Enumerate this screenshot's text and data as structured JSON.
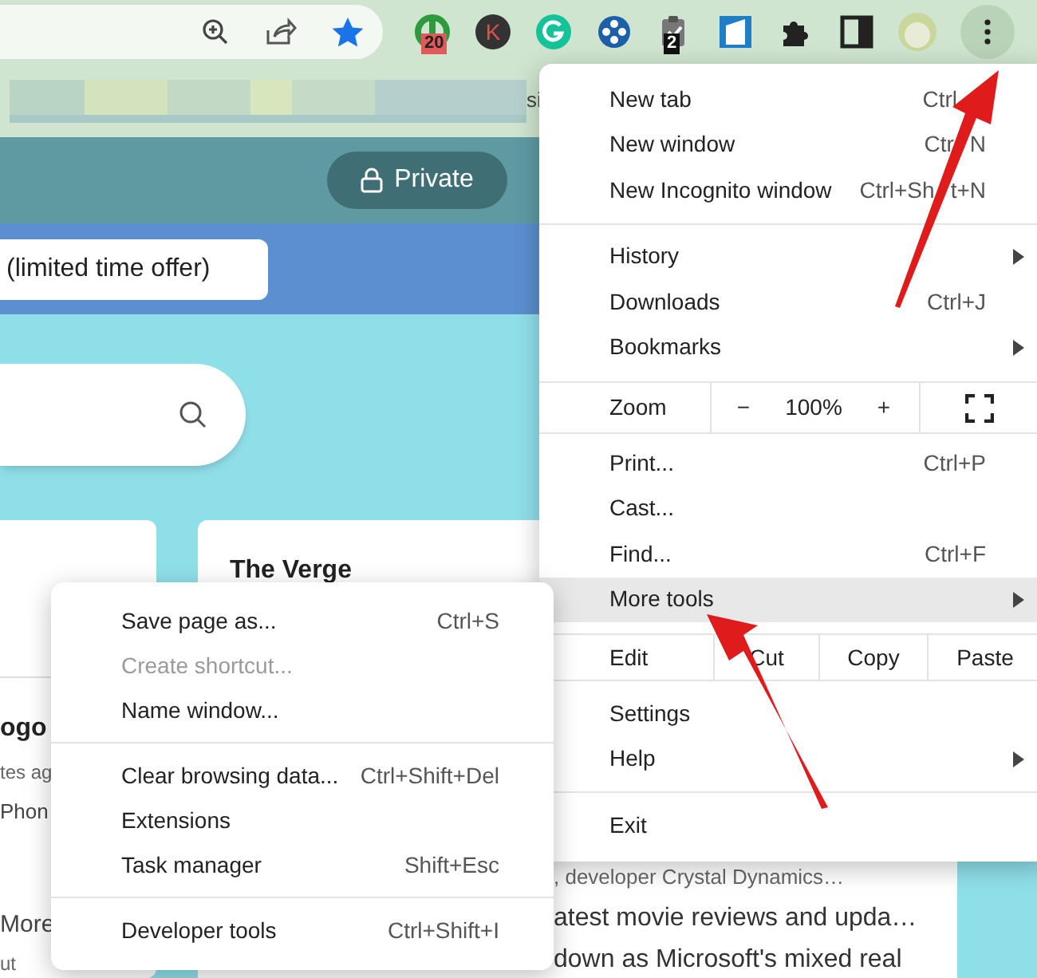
{
  "toolbar": {
    "extensions": [
      {
        "kind": "ring",
        "badge": "20"
      },
      {
        "kind": "letter",
        "letter": "K"
      },
      {
        "kind": "grammar"
      },
      {
        "kind": "dots"
      },
      {
        "kind": "clip",
        "badge": "2"
      },
      {
        "kind": "square"
      },
      {
        "kind": "puzzle"
      },
      {
        "kind": "sidepanel"
      },
      {
        "kind": "avatar"
      }
    ]
  },
  "bookmarks_bar": {
    "fragment": "si"
  },
  "page": {
    "private_button": "Private",
    "offer": "(limited time offer)",
    "card_title": "The Verge",
    "left_card": [
      "ogo",
      "tes ag",
      "Phon",
      "More",
      "ut"
    ],
    "right_card": [
      ", developer Crystal Dynamics…",
      "atest movie reviews and upda…",
      "down as Microsoft's mixed real"
    ]
  },
  "menu": {
    "items": [
      {
        "kind": "item",
        "label": "New tab",
        "shortcut_parts": [
          "Ctrl"
        ],
        "shortcut_cut": true,
        "submenu": false,
        "selected": false
      },
      {
        "kind": "item",
        "label": "New window",
        "shortcut_parts": [
          "Ctr",
          "N"
        ],
        "submenu": false,
        "selected": false
      },
      {
        "kind": "item",
        "label": "New Incognito window",
        "shortcut_parts": [
          "Ctrl+Sh",
          "t+N"
        ],
        "submenu": false,
        "selected": false
      },
      {
        "kind": "divider"
      },
      {
        "kind": "item",
        "label": "History",
        "submenu": true,
        "selected": false
      },
      {
        "kind": "item",
        "label": "Downloads",
        "shortcut": "Ctrl+J",
        "submenu": false,
        "selected": false
      },
      {
        "kind": "item",
        "label": "Bookmarks",
        "submenu": true,
        "selected": false
      },
      {
        "kind": "zoom",
        "label": "Zoom",
        "minus": "−",
        "value": "100%",
        "plus": "+"
      },
      {
        "kind": "item",
        "label": "Print...",
        "shortcut": "Ctrl+P",
        "submenu": false,
        "selected": false
      },
      {
        "kind": "item",
        "label": "Cast...",
        "submenu": false,
        "selected": false
      },
      {
        "kind": "item",
        "label": "Find...",
        "shortcut": "Ctrl+F",
        "submenu": false,
        "selected": false
      },
      {
        "kind": "item",
        "label": "More tools",
        "submenu": true,
        "selected": true
      },
      {
        "kind": "edit",
        "label": "Edit",
        "buttons": [
          "Cut",
          "Copy",
          "Paste"
        ]
      },
      {
        "kind": "item",
        "label": "Settings",
        "submenu": false,
        "selected": false
      },
      {
        "kind": "item",
        "label": "Help",
        "submenu": true,
        "selected": false
      },
      {
        "kind": "divider"
      },
      {
        "kind": "item",
        "label": "Exit",
        "submenu": false,
        "selected": false
      }
    ]
  },
  "submenu": {
    "items": [
      {
        "kind": "item",
        "label": "Save page as...",
        "shortcut": "Ctrl+S",
        "disabled": false
      },
      {
        "kind": "item",
        "label": "Create shortcut...",
        "disabled": true
      },
      {
        "kind": "item",
        "label": "Name window...",
        "disabled": false
      },
      {
        "kind": "divider"
      },
      {
        "kind": "item",
        "label": "Clear browsing data...",
        "shortcut": "Ctrl+Shift+Del",
        "disabled": false
      },
      {
        "kind": "item",
        "label": "Extensions",
        "disabled": false
      },
      {
        "kind": "item",
        "label": "Task manager",
        "shortcut": "Shift+Esc",
        "disabled": false
      },
      {
        "kind": "divider"
      },
      {
        "kind": "item",
        "label": "Developer tools",
        "shortcut": "Ctrl+Shift+I",
        "disabled": false
      }
    ]
  }
}
